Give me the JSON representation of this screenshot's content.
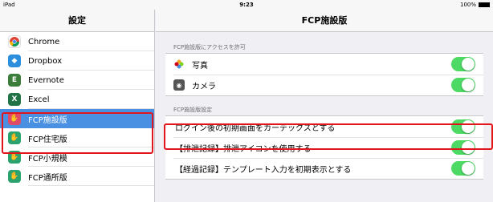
{
  "status": {
    "device": "iPad",
    "time": "9:23",
    "battery": "100%"
  },
  "left": {
    "title": "設定",
    "apps": [
      {
        "label": "Chrome",
        "icon": "chrome-icon",
        "color": "#ffffff"
      },
      {
        "label": "Dropbox",
        "icon": "dropbox-icon",
        "color": "#2c8fde"
      },
      {
        "label": "Evernote",
        "icon": "evernote-icon",
        "color": "#3b7d3b"
      },
      {
        "label": "Excel",
        "icon": "excel-icon",
        "color": "#217346"
      },
      {
        "label": "FCP施設版",
        "icon": "fcp-icon",
        "color": "#e04a6a"
      },
      {
        "label": "FCP住宅版",
        "icon": "fcp-icon",
        "color": "#2aa36e"
      },
      {
        "label": "FCP小規模",
        "icon": "fcp-icon",
        "color": "#2aa36e"
      },
      {
        "label": "FCP通所版",
        "icon": "fcp-icon",
        "color": "#2aa36e"
      }
    ]
  },
  "right": {
    "title": "FCP施設版",
    "section1": "FCP施設版にアクセスを許可",
    "photos_label": "写真",
    "camera_label": "カメラ",
    "section2": "FCP施設版設定",
    "setting1": "ログイン後の初期画面をカーデックスとする",
    "setting2": "【排泄記録】排泄アイコンを使用する",
    "setting3": "【経過記録】テンプレート入力を初期表示とする"
  }
}
